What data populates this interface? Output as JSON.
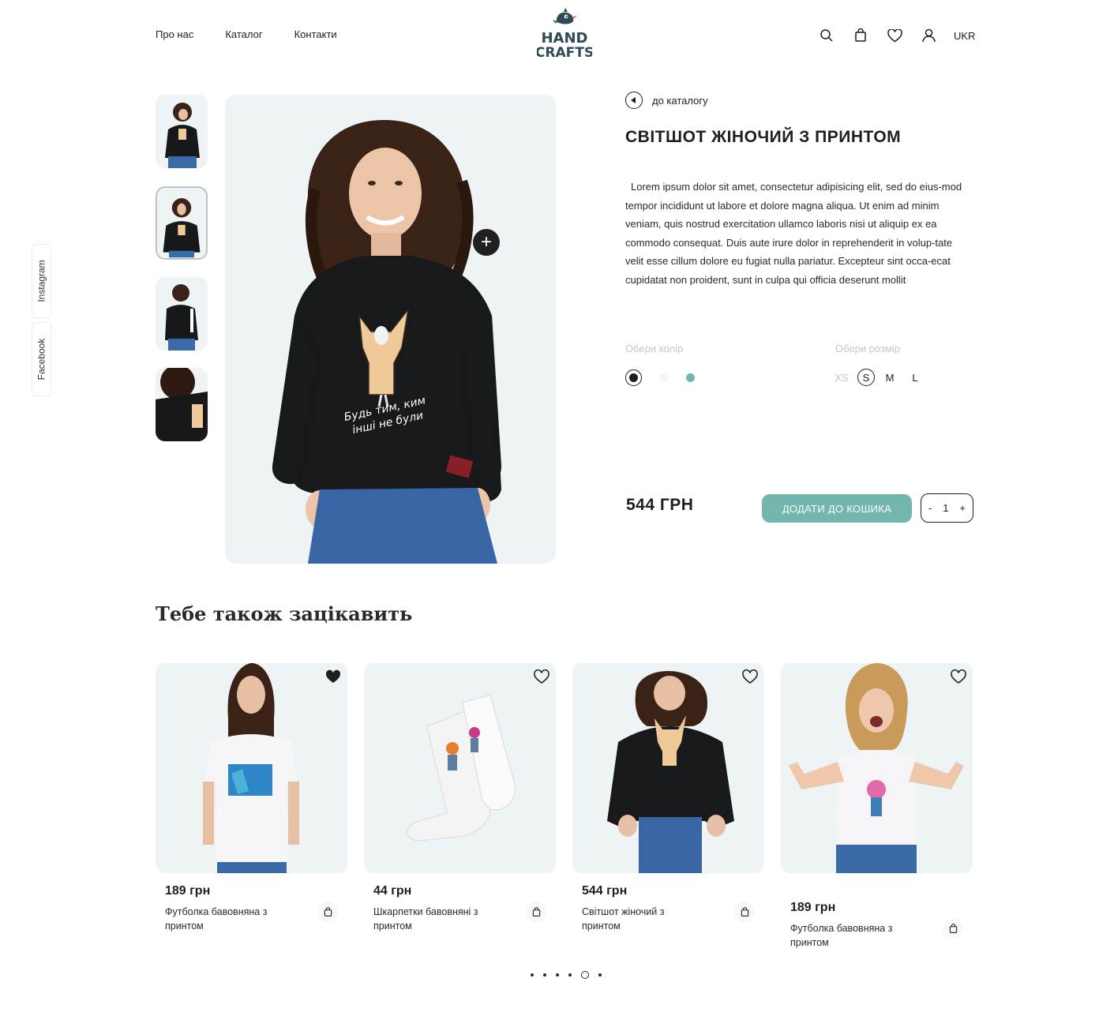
{
  "header": {
    "nav": [
      "Про нас",
      "Каталог",
      "Контакти"
    ],
    "logo_text": [
      "HAND",
      "CRAFTS"
    ],
    "icons": [
      "search-icon",
      "bag-icon",
      "heart-icon",
      "user-icon"
    ],
    "language": "UKR"
  },
  "social": [
    "Instagram",
    "Facebook"
  ],
  "product": {
    "back_label": "до каталогу",
    "title": "СВІТШОТ ЖІНОЧИЙ З ПРИНТОМ",
    "description": "Lorem ipsum dolor sit amet, consectetur adipisicing elit, sed do eius-mod tempor incididunt ut labore et dolore magna aliqua. Ut enim ad minim veniam, quis nostrud exercitation ullamco laboris nisi ut aliquip ex ea commodo consequat. Duis aute irure dolor in reprehenderit in volup-tate velit esse cillum dolore eu fugiat nulla pariatur. Excepteur sint occa-ecat cupidatat non proident, sunt in culpa qui officia deserunt mollit",
    "color_label": "Обери колір",
    "colors": [
      "#1e1e1e",
      "#f3f5f6",
      "#72b6ac"
    ],
    "selected_color": "#1e1e1e",
    "size_label": "Обери розмір",
    "sizes": [
      "XS",
      "S",
      "M",
      "L"
    ],
    "selected_size": "S",
    "print_text": [
      "Будь тим, ким",
      "інші не були"
    ],
    "price": "544 ГРН",
    "add_to_cart": "ДОДАТИ ДО КОШИКА",
    "qty_minus": "-",
    "quantity": "1",
    "qty_plus": "+"
  },
  "related": {
    "title": "Тебе також зацікавить",
    "items": [
      {
        "price": "189 грн",
        "name": "Футболка бавовняна з принтом",
        "favorited": true
      },
      {
        "price": "44 грн",
        "name": "Шкарпетки бавовняні з принтом",
        "favorited": false
      },
      {
        "price": "544 грн",
        "name": "Світшот жіночий з принтом",
        "favorited": false
      },
      {
        "price": "189 грн",
        "name": "Футболка бавовняна з принтом",
        "favorited": false
      }
    ],
    "pagination": {
      "count": 6,
      "active": 5
    }
  },
  "colors": {
    "accent": "#72b6ac",
    "dark": "#1e1e1e",
    "photo_bg": "#eef3f6",
    "muted": "#c2c7ca"
  }
}
